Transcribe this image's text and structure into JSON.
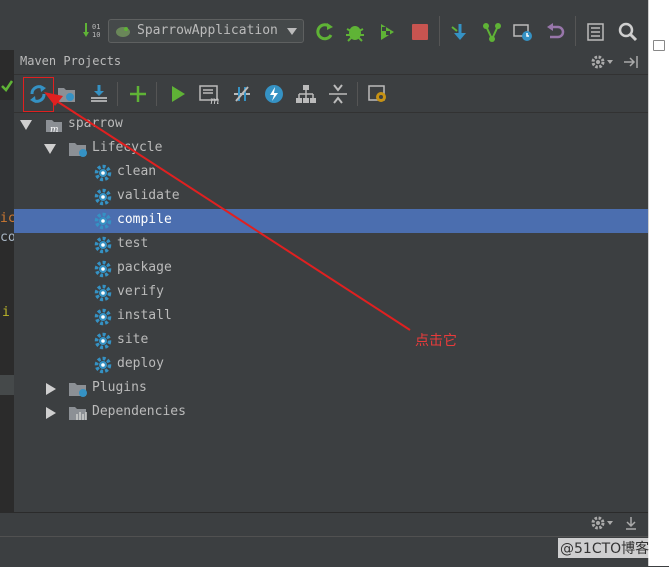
{
  "toolbar": {
    "run_config_label": "SparrowApplication",
    "icons": [
      "build-binary-icon",
      "rerun-icon",
      "debug-icon",
      "coverage-icon",
      "stop-icon",
      "vcs-update-icon",
      "vcs-branch-icon",
      "history-icon",
      "revert-icon",
      "project-structure-icon",
      "search-icon"
    ]
  },
  "maven_panel": {
    "title": "Maven Projects",
    "toolbar_icons": [
      "reimport-icon",
      "generate-sources-icon",
      "download-icon",
      "add-icon",
      "run-icon",
      "execute-goal-icon",
      "toggle-offline-icon",
      "skip-tests-icon",
      "show-dependencies-icon",
      "collapse-all-icon",
      "settings-icon"
    ],
    "tree": {
      "project": "sparrow",
      "lifecycle_label": "Lifecycle",
      "lifecycle_items": [
        "clean",
        "validate",
        "compile",
        "test",
        "package",
        "verify",
        "install",
        "site",
        "deploy"
      ],
      "selected_item": "compile",
      "plugins_label": "Plugins",
      "dependencies_label": "Dependencies"
    }
  },
  "editor_fragments": {
    "line1": "ic",
    "line2": "co",
    "line3": "i"
  },
  "annotation": {
    "text": "点击它",
    "color": "#e83b3b"
  },
  "watermark": "@51CTO博客",
  "colors": {
    "panel_bg": "#3c3f41",
    "selection": "#4b6eaf",
    "gear_blue": "#3592c4"
  }
}
